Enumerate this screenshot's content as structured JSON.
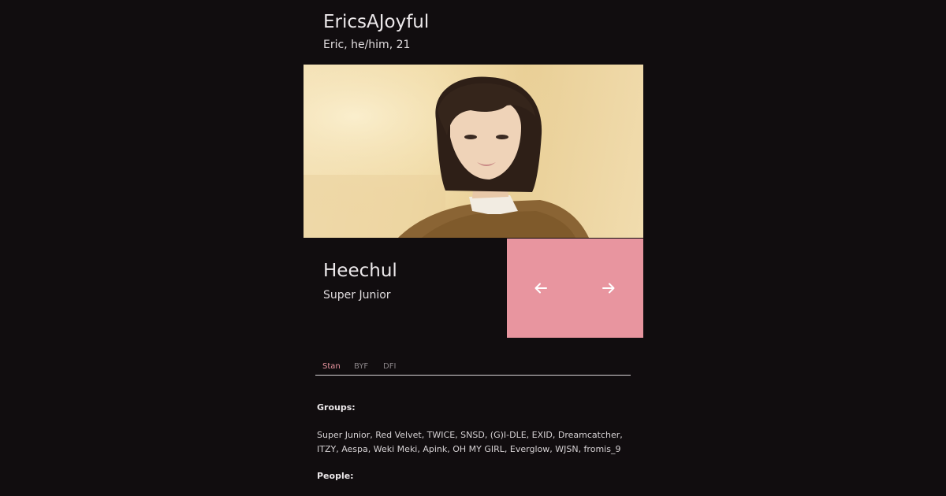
{
  "profile": {
    "username": "EricsAJoyful",
    "meta": "Eric, he/him, 21"
  },
  "idol": {
    "name": "Heechul",
    "group": "Super Junior"
  },
  "navigation": {
    "prev_icon": "arrow-left-icon",
    "next_icon": "arrow-right-icon"
  },
  "tabs": [
    {
      "label": "Stan",
      "active": true
    },
    {
      "label": "BYF",
      "active": false
    },
    {
      "label": "DFI",
      "active": false
    }
  ],
  "sections": {
    "groups_label": "Groups:",
    "groups_text": "Super Junior, Red Velvet, TWICE, SNSD, (G)I-DLE, EXID, Dreamcatcher, ITZY, Aespa, Weki Meki, Apink, OH MY GIRL, Everglow, WJSN, fromis_9",
    "people_label": "People:"
  },
  "colors": {
    "background": "#110d0f",
    "accent": "#e8959f",
    "text": "#ece8ea",
    "tab_inactive": "#8b8588"
  }
}
